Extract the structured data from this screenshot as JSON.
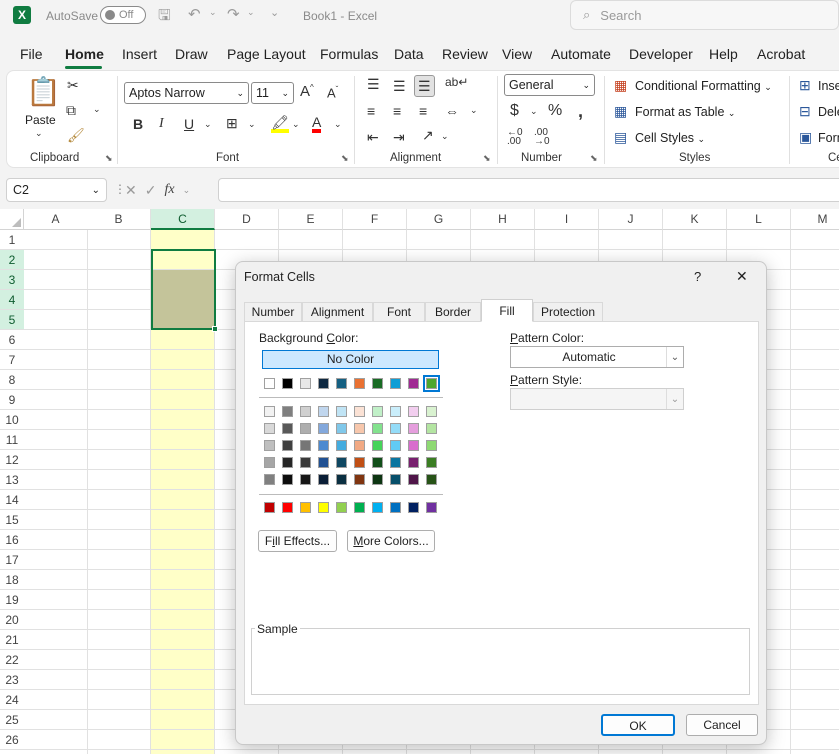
{
  "titlebar": {
    "autosave_label": "AutoSave",
    "autosave_state": "Off",
    "book_title": "Book1",
    "separator": "-",
    "app_name": "Excel",
    "search_placeholder": "Search"
  },
  "menu": [
    "File",
    "Home",
    "Insert",
    "Draw",
    "Page Layout",
    "Formulas",
    "Data",
    "Review",
    "View",
    "Automate",
    "Developer",
    "Help",
    "Acrobat"
  ],
  "ribbon": {
    "clipboard": {
      "paste": "Paste",
      "label": "Clipboard"
    },
    "font": {
      "name": "Aptos Narrow",
      "size": "11",
      "label": "Font"
    },
    "alignment": {
      "label": "Alignment"
    },
    "number": {
      "format": "General",
      "label": "Number"
    },
    "styles": {
      "conditional": "Conditional Formatting",
      "table": "Format as Table",
      "cell": "Cell Styles",
      "label": "Styles"
    },
    "cells": {
      "insert": "Inse",
      "delete": "Dele",
      "format": "Forn",
      "label": "Ce"
    }
  },
  "formula_bar": {
    "name_box": "C2",
    "formula": ""
  },
  "grid": {
    "columns": [
      "A",
      "B",
      "C",
      "D",
      "E",
      "F",
      "G",
      "H",
      "I",
      "J",
      "K",
      "L",
      "M"
    ],
    "rows": [
      "1",
      "2",
      "3",
      "4",
      "5",
      "6",
      "7",
      "8",
      "9",
      "10",
      "11",
      "12",
      "13",
      "14",
      "15",
      "16",
      "17",
      "18",
      "19",
      "20",
      "21",
      "22",
      "23",
      "24",
      "25",
      "26"
    ],
    "fill_color": "#ffffc8",
    "selection_fill": "#c4c49a"
  },
  "dialog": {
    "title": "Format Cells",
    "help": "?",
    "close": "✕",
    "tabs": [
      "Number",
      "Alignment",
      "Font",
      "Border",
      "Fill",
      "Protection"
    ],
    "active_tab": "Fill",
    "background_color_label_pre": "Background ",
    "background_color_label_key": "C",
    "background_color_label_post": "olor:",
    "no_color": "No Color",
    "theme_row": [
      "#ffffff",
      "#000000",
      "#e8e8e8",
      "#0e2841",
      "#156082",
      "#e97132",
      "#196b24",
      "#0f9ed5",
      "#a02b93",
      "#4ea72e"
    ],
    "tint_rows": [
      [
        "#f2f2f2",
        "#7f7f7f",
        "#d0d0d0",
        "#c0d6ee",
        "#c0e4f5",
        "#fbe2d5",
        "#c1f0c8",
        "#caeefb",
        "#f2ceef",
        "#d9f2d0"
      ],
      [
        "#d9d9d9",
        "#595959",
        "#aeaeae",
        "#83a8dc",
        "#80c8ea",
        "#f7c7ac",
        "#83e28e",
        "#94dcf8",
        "#e59edd",
        "#b4e5a2"
      ],
      [
        "#bfbfbf",
        "#404040",
        "#767676",
        "#4d8ad0",
        "#44acdf",
        "#f1a983",
        "#46d35a",
        "#61cbf4",
        "#d86dcd",
        "#8ed973"
      ],
      [
        "#a6a6a6",
        "#262626",
        "#3a3a3a",
        "#215193",
        "#0f4761",
        "#c04f15",
        "#124f1a",
        "#0b76a0",
        "#78206e",
        "#3b7d23"
      ],
      [
        "#808080",
        "#0d0d0d",
        "#171717",
        "#0a1e36",
        "#0a2f41",
        "#803510",
        "#0d3512",
        "#074f6a",
        "#4f1549",
        "#275317"
      ]
    ],
    "standard_row": [
      "#c00000",
      "#ff0000",
      "#ffc000",
      "#ffff00",
      "#92d050",
      "#00b050",
      "#00b0f0",
      "#0070c0",
      "#002060",
      "#7030a0"
    ],
    "fill_effects_key": "i",
    "fill_effects_pre": "F",
    "fill_effects_post": "ll Effects...",
    "more_colors_key": "M",
    "more_colors_post": "ore Colors...",
    "pattern_color_key": "P",
    "pattern_color_post": "attern Color:",
    "pattern_color_value": "Automatic",
    "pattern_style_key": "P",
    "pattern_style_post": "attern Style:",
    "pattern_style_value": "",
    "sample_label": "Sample",
    "ok": "OK",
    "cancel": "Cancel"
  }
}
